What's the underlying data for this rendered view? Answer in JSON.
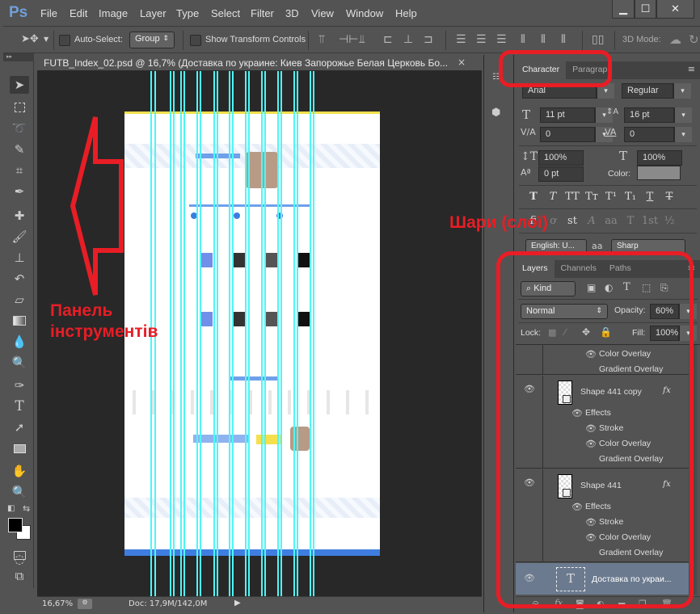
{
  "app": {
    "logo": "Ps"
  },
  "menu": [
    "File",
    "Edit",
    "Image",
    "Layer",
    "Type",
    "Select",
    "Filter",
    "3D",
    "View",
    "Window",
    "Help"
  ],
  "window_controls": {
    "minimize": "▁",
    "maximize": "☐",
    "close": "✕"
  },
  "options_bar": {
    "auto_select_label": "Auto-Select:",
    "auto_select_value": "Group",
    "show_transform_label": "Show Transform Controls",
    "mode_label": "3D Mode:"
  },
  "document": {
    "tab_title": "FUTB_Index_02.psd @ 16,7% (Доставка по украине: Киев Запорожье Белая Церковь Бо...",
    "close": "×",
    "zoom": "16,67%",
    "doc_size": "Doc: 17,9M/142,0M"
  },
  "annotations": {
    "tools_panel": [
      "Панель",
      "інструментів"
    ],
    "layers": "Шари (слої)"
  },
  "character_panel": {
    "tabs": [
      "Character",
      "Paragraph"
    ],
    "font_family": "Arial",
    "font_style": "Regular",
    "font_size": "11 pt",
    "leading": "16 pt",
    "kerning": "0",
    "tracking": "0",
    "vertical_scale": "100%",
    "horizontal_scale": "100%",
    "baseline_shift": "0 pt",
    "color_label": "Color:",
    "color": "#8a8a8a",
    "style_buttons": [
      "T",
      "T",
      "TT",
      "Tт",
      "T¹",
      "T₁",
      "T",
      "T"
    ],
    "opentype_buttons": [
      "fi",
      "ơ",
      "st",
      "A",
      "aa",
      "T",
      "1st",
      "½"
    ],
    "language": "English: U...",
    "aa_label": "aa",
    "antialias": "Sharp"
  },
  "layers_panel": {
    "tabs": [
      "Layers",
      "Channels",
      "Paths"
    ],
    "filter_kind": "Kind",
    "blend_mode": "Normal",
    "opacity_label": "Opacity:",
    "opacity": "60%",
    "lock_label": "Lock:",
    "fill_label": "Fill:",
    "fill": "100%",
    "top_effects": [
      "Color Overlay",
      "Gradient Overlay"
    ],
    "layers": [
      {
        "name": "Shape 441 copy",
        "fx": "fx",
        "effects_label": "Effects",
        "effects": [
          "Stroke",
          "Color Overlay",
          "Gradient Overlay"
        ]
      },
      {
        "name": "Shape 441",
        "fx": "fx",
        "effects_label": "Effects",
        "effects": [
          "Stroke",
          "Color Overlay",
          "Gradient Overlay"
        ]
      },
      {
        "name": "Доставка по украи...",
        "type_icon": "T",
        "selected": true
      }
    ]
  },
  "colors": {
    "accent_red": "#e81d25",
    "guide": "#4ff6f6",
    "selected_layer": "#6b7a8f"
  }
}
